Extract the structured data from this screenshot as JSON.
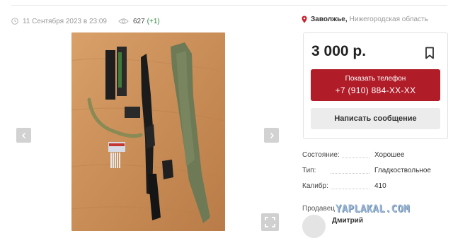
{
  "listing": {
    "date": "11 Сентября 2023 в 23:09",
    "views": "627",
    "views_delta": "(+1)"
  },
  "location": {
    "city": "Заволжье,",
    "region": "Нижегородская область"
  },
  "price_card": {
    "price": "3 000 р.",
    "phone_button_label": "Показать телефон",
    "phone_number": "+7 (910) 884-XX-XX",
    "message_button_label": "Написать сообщение"
  },
  "specs": [
    {
      "key": "Состояние:",
      "value": "Хорошее"
    },
    {
      "key": "Тип:",
      "value": "Гладкоствольное"
    },
    {
      "key": "Калибр:",
      "value": "410"
    }
  ],
  "seller": {
    "label": "Продавец",
    "name": "Дмитрий"
  },
  "watermark": "YAPLAKAL.COM",
  "colors": {
    "accent_red": "#b01c28",
    "delta_green": "#2e8b3d",
    "pin_red": "#c8202e"
  },
  "icons": [
    "clock-icon",
    "eye-icon",
    "location-pin-icon",
    "bookmark-icon",
    "chevron-left-icon",
    "chevron-right-icon",
    "fullscreen-icon"
  ]
}
